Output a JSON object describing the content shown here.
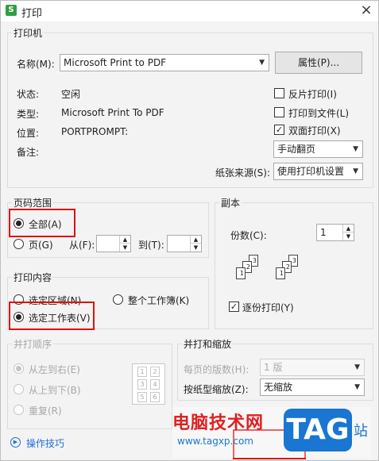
{
  "window": {
    "title": "打印",
    "app_icon_letter": "S",
    "close_glyph": "×"
  },
  "printer": {
    "group_title": "打印机",
    "name_label": "名称(M):",
    "name_value": "Microsoft Print to PDF",
    "properties_button": "属性(P)...",
    "status_label": "状态:",
    "status_value": "空闲",
    "type_label": "类型:",
    "type_value": "Microsoft Print To PDF",
    "where_label": "位置:",
    "where_value": "PORTPROMPT:",
    "comment_label": "备注:",
    "reverse_print": {
      "label": "反片打印(I)",
      "checked": false
    },
    "print_to_file": {
      "label": "打印到文件(L)",
      "checked": false
    },
    "duplex": {
      "label": "双面打印(X)",
      "checked": true
    },
    "duplex_mode": "手动翻页",
    "paper_source_label": "纸张来源(S):",
    "paper_source_value": "使用打印机设置"
  },
  "page_range": {
    "group_title": "页码范围",
    "all_label": "全部(A)",
    "pages_label": "页(G)",
    "from_label": "从(F):",
    "to_label": "到(T):",
    "selected": "all"
  },
  "copies": {
    "group_title": "副本",
    "count_label": "份数(C):",
    "count_value": "1",
    "collate_label": "逐份打印(Y)",
    "collate_checked": true,
    "collate_icon_pages": [
      "1",
      "2",
      "3"
    ]
  },
  "print_content": {
    "group_title": "打印内容",
    "selection_label": "选定区域(N)",
    "whole_workbook_label": "整个工作簿(K)",
    "selected_sheet_label": "选定工作表(V)",
    "selected": "selected_sheet"
  },
  "print_order": {
    "group_title": "并打顺序",
    "left_to_right": "从左到右(E)",
    "top_to_bottom": "从上到下(B)",
    "repeat": "重复(R)",
    "preview_numbers": [
      "1",
      "2",
      "3",
      "4",
      "5",
      "6"
    ]
  },
  "scaling": {
    "group_title": "并打和缩放",
    "pages_per_sheet_label": "每页的版数(H):",
    "pages_per_sheet_value": "1 版",
    "scale_to_paper_label": "按纸型缩放(Z):",
    "scale_to_paper_value": "无缩放"
  },
  "footer": {
    "tips_label": "操作技巧"
  },
  "watermark": {
    "text": "电脑技术网",
    "url": "www.tagxp.com",
    "logo": "TAG",
    "suffix": "站"
  },
  "colors": {
    "highlight_red": "#e01010",
    "tips_blue": "#1e6fd9",
    "logo_blue": "#1976d2"
  }
}
